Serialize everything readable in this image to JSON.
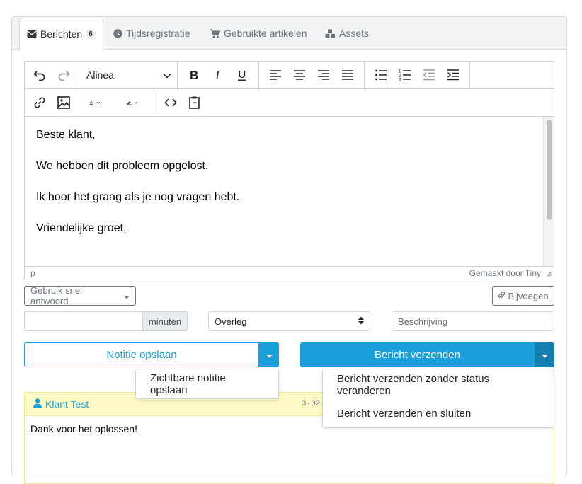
{
  "tabs": [
    {
      "label": "Berichten",
      "badge": "6",
      "icon": "envelope-icon",
      "active": true
    },
    {
      "label": "Tijdsregistratie",
      "icon": "clock-icon"
    },
    {
      "label": "Gebruikte artikelen",
      "icon": "cart-icon"
    },
    {
      "label": "Assets",
      "icon": "cubes-icon"
    }
  ],
  "editor": {
    "block_format": "Alinea",
    "content": [
      "Beste klant,",
      "We hebben dit probleem opgelost.",
      "Ik hoor het graag als je nog vragen hebt.",
      "Vriendelijke groet,"
    ],
    "status_path": "p",
    "branding": "Gemaakt door Tiny"
  },
  "quick_reply": {
    "label": "Gebruik snel antwoord"
  },
  "attach": {
    "label": "Bijvoegen"
  },
  "time_input": {
    "value": "",
    "addon": "minuten"
  },
  "type_select": {
    "value": "Overleg"
  },
  "description": {
    "placeholder": "Beschrijving"
  },
  "note_button": {
    "label": "Notitie opslaan"
  },
  "send_button": {
    "label": "Bericht verzenden"
  },
  "note_menu": {
    "items": [
      "Zichtbare notitie opslaan"
    ]
  },
  "send_menu": {
    "items": [
      "Bericht verzenden zonder status veranderen",
      "Bericht verzenden en sluiten"
    ]
  },
  "message": {
    "author": "Klant Test",
    "date_fragment": "3-02-",
    "body": "Dank voor het oplossen!"
  },
  "colors": {
    "accent": "#1a9fdb",
    "accent_dark": "#157fb0",
    "yellow_bg": "#fdf9c4",
    "yellow_border": "#f3e68a"
  }
}
